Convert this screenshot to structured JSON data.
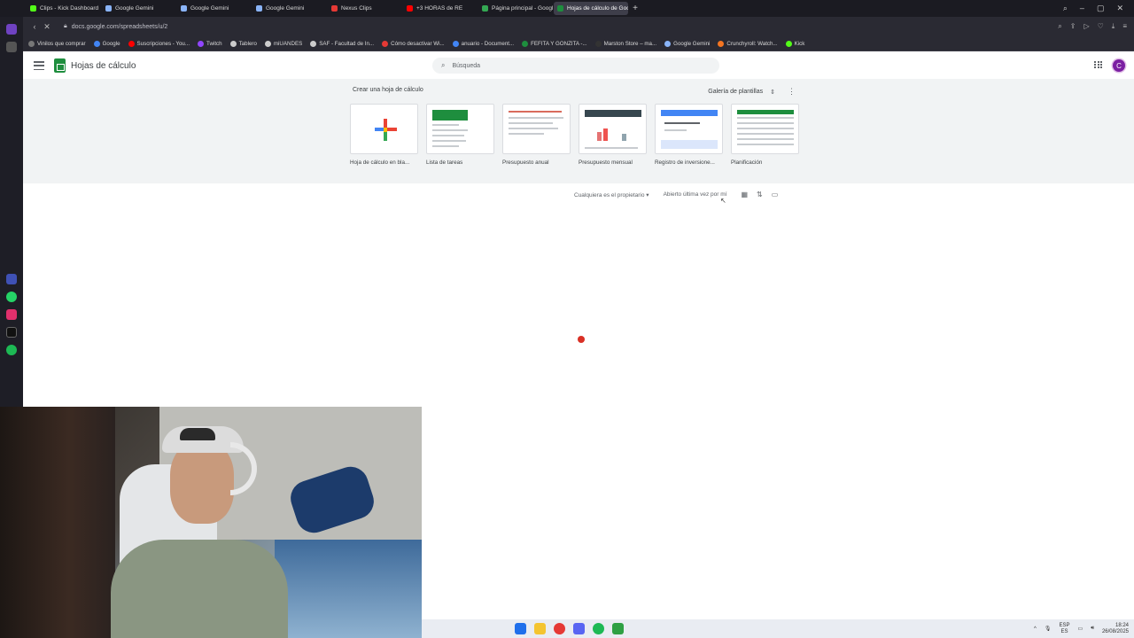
{
  "browser": {
    "tabs": [
      {
        "label": "Clips - Kick Dashboard",
        "color": "#53fc18"
      },
      {
        "label": "Google Gemini",
        "color": "#8ab4f8"
      },
      {
        "label": "Google Gemini",
        "color": "#8ab4f8"
      },
      {
        "label": "Google Gemini",
        "color": "#8ab4f8"
      },
      {
        "label": "Nexus Clips",
        "color": "#e53935"
      },
      {
        "label": "+3 HORAS de RE",
        "color": "#ff0000"
      },
      {
        "label": "Página principal - Google",
        "color": "#34a853"
      },
      {
        "label": "Hojas de cálculo de Goo",
        "color": "#1e8e3e",
        "active": true
      }
    ],
    "url": "docs.google.com/spreadsheets/u/2",
    "bookmarks": [
      {
        "label": "Vinilos que comprar",
        "color": "#777"
      },
      {
        "label": "Google",
        "color": "#4285f4"
      },
      {
        "label": "Suscripciones - You...",
        "color": "#ff0000"
      },
      {
        "label": "Twitch",
        "color": "#9146ff"
      },
      {
        "label": "Tablero",
        "color": "#ccc"
      },
      {
        "label": "miUANDES",
        "color": "#ccc"
      },
      {
        "label": "SAF - Facultad de In...",
        "color": "#ccc"
      },
      {
        "label": "Cómo desactivar Wi...",
        "color": "#e53935"
      },
      {
        "label": "anuario - Document...",
        "color": "#4285f4"
      },
      {
        "label": "FEFITA Y GONZITA -...",
        "color": "#1e8e3e"
      },
      {
        "label": "Marston Store – ma...",
        "color": "#333"
      },
      {
        "label": "Google Gemini",
        "color": "#8ab4f8"
      },
      {
        "label": "Crunchyroll: Watch...",
        "color": "#f47521"
      },
      {
        "label": "Kick",
        "color": "#53fc18"
      }
    ]
  },
  "sheets": {
    "app_title": "Hojas de cálculo",
    "search_placeholder": "Búsqueda",
    "avatar_letter": "C",
    "create_heading": "Crear una hoja de cálculo",
    "gallery_label": "Galería de plantillas",
    "templates": [
      {
        "label": "Hoja de cálculo en bla..."
      },
      {
        "label": "Lista de tareas"
      },
      {
        "label": "Presupuesto anual"
      },
      {
        "label": "Presupuesto mensual"
      },
      {
        "label": "Registro de inversione..."
      },
      {
        "label": "Planificación"
      }
    ],
    "owner_filter": "Cualquiera es el propietario",
    "sort_label": "Abierto última vez por mí"
  },
  "taskbar": {
    "lang_top": "ESP",
    "lang_bottom": "ES",
    "time": "18:24",
    "date": "26/08/2025"
  },
  "colors": {
    "sheets_green": "#1e8e3e",
    "avatar": "#7b1fa2",
    "loading_dot": "#d93025"
  }
}
